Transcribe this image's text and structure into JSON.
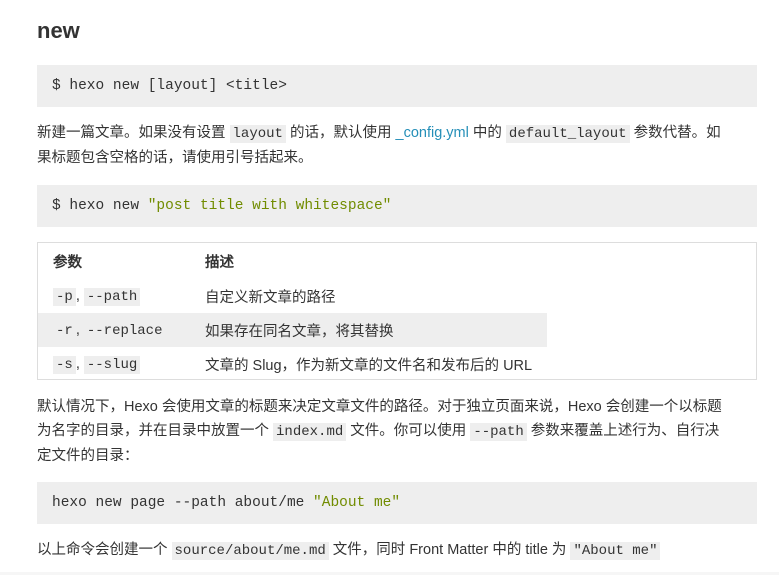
{
  "heading": "new",
  "code1": {
    "prompt": "$",
    "text": "hexo new [layout] <title>"
  },
  "para1": {
    "t1": "新建一篇文章。如果没有设置 ",
    "c1": "layout",
    "t2": " 的话，默认使用 ",
    "link": "_config.yml",
    "t3": " 中的 ",
    "c2": "default_layout",
    "t4": " 参数代替。如",
    "t5": "果标题包含空格的话，请使用引号括起来。"
  },
  "code2": {
    "prompt": "$",
    "cmd": "hexo new ",
    "str": "\"post title with whitespace\""
  },
  "table": {
    "headers": [
      "参数",
      "描述"
    ],
    "rows": [
      {
        "short": "-p",
        "sep": ",",
        "long": "--path",
        "desc": "自定义新文章的路径"
      },
      {
        "short": "-r",
        "sep": ",",
        "long": "--replace",
        "desc": "如果存在同名文章，将其替换"
      },
      {
        "short": "-s",
        "sep": ",",
        "long": "--slug",
        "desc": "文章的 Slug，作为新文章的文件名和发布后的 URL"
      }
    ]
  },
  "para2": {
    "l1": "默认情况下，Hexo 会使用文章的标题来决定文章文件的路径。对于独立页面来说，Hexo 会创建一个以标题",
    "l2a": "为名字的目录，并在目录中放置一个 ",
    "c1": "index.md",
    "l2b": " 文件。你可以使用 ",
    "c2": "--path",
    "l2c": " 参数来覆盖上述行为、自行决",
    "l3": "定文件的目录："
  },
  "code3": {
    "cmd": "hexo new page --path about/me ",
    "str": "\"About me\""
  },
  "para3": {
    "t1": "以上命令会创建一个 ",
    "c1": "source/about/me.md",
    "t2": " 文件，同时 Front Matter 中的 title 为 ",
    "c2": "\"About me\""
  },
  "colors": {
    "code_bg": "#eeeeee",
    "string": "#718c00",
    "link": "#258fb8",
    "text": "#333333"
  }
}
